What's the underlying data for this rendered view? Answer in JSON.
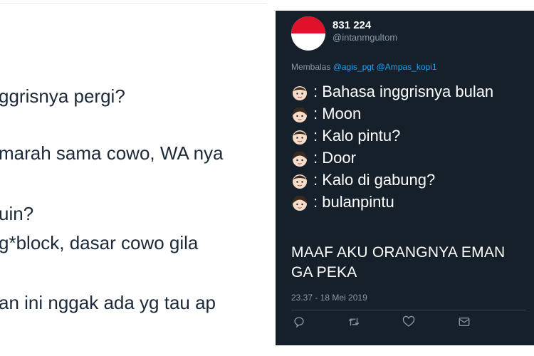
{
  "left_tweet": {
    "lines": [
      "ggrisnya pergi?",
      "marah sama cowo, WA nya",
      "uin?",
      "g*block, dasar cowo gila",
      "an ini nggak ada yg tau ap"
    ]
  },
  "right_tweet": {
    "display_name": "831 224",
    "handle": "@intanmgultom",
    "reply_prefix": "Membalas",
    "reply_mentions": [
      "@agis_pgt",
      "@Ampas_kopi1"
    ],
    "conversation": [
      {
        "icon": "boy-face-emoji",
        "text": ": Bahasa inggrisnya bulan"
      },
      {
        "icon": "girl-face-emoji",
        "text": ": Moon"
      },
      {
        "icon": "boy-face-emoji",
        "text": ": Kalo pintu?"
      },
      {
        "icon": "girl-face-emoji",
        "text": ": Door"
      },
      {
        "icon": "boy-face-emoji",
        "text": ": Kalo di gabung?"
      },
      {
        "icon": "girl-face-emoji",
        "text": ": bulanpintu"
      }
    ],
    "punchline": [
      "MAAF AKU ORANGNYA EMAN",
      "GA PEKA"
    ],
    "timestamp": "23.37 - 18 Mei 2019",
    "actions": [
      "reply-icon",
      "retweet-icon",
      "like-icon",
      "share-icon"
    ]
  },
  "colors": {
    "dark_bg": "#15202b",
    "secondary_text": "#8899a6",
    "link": "#1da1f2",
    "flag_red": "#e0112b"
  }
}
